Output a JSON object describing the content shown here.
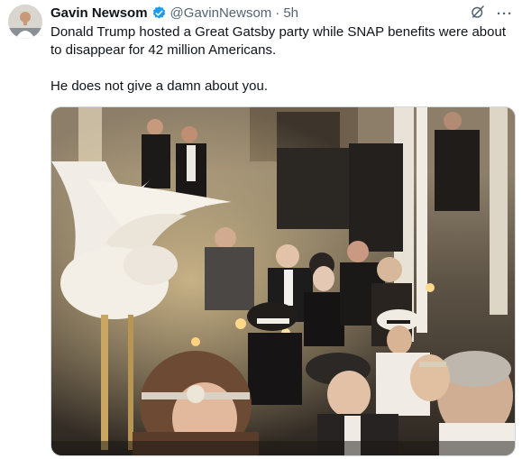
{
  "author": {
    "name": "Gavin Newsom",
    "handle": "@GavinNewsom",
    "separator": "·",
    "time": "5h"
  },
  "icons": {
    "verified": "verified-badge-icon",
    "grok": "grok-icon",
    "more": "more-icon"
  },
  "colors": {
    "verified_blue": "#1d9bf0",
    "secondary_text": "#536471",
    "primary_text": "#0f1419"
  },
  "post": {
    "paragraph1": "Donald Trump hosted a Great Gatsby party while SNAP benefits were about to disappear for 42 million Americans.",
    "paragraph2": "He does not give a damn about you."
  },
  "more_glyph": "···"
}
